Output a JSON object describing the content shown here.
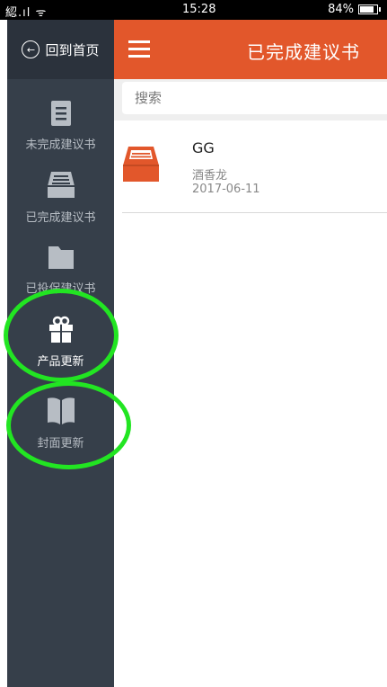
{
  "status_bar": {
    "left_text": "綛.ıl ᯤ",
    "time": "15:28",
    "battery_percent": "84%",
    "battery_level": 0.84
  },
  "sidebar": {
    "home_label": "回到首页",
    "items": [
      {
        "label": "未完成建议书",
        "icon": "document-icon",
        "active": false
      },
      {
        "label": "已完成建议书",
        "icon": "inbox-icon",
        "active": false
      },
      {
        "label": "已投保建议书",
        "icon": "folder-icon",
        "active": false
      },
      {
        "label": "产品更新",
        "icon": "gift-icon",
        "active": true
      },
      {
        "label": "封面更新",
        "icon": "book-icon",
        "active": false
      }
    ]
  },
  "header": {
    "title": "已完成建议书",
    "menu_icon": "hamburger-menu-icon"
  },
  "search": {
    "placeholder": "搜索"
  },
  "list": [
    {
      "title": "GG",
      "subtitle": "酒香龙",
      "date": "2017-06-11",
      "icon": "inbox-tray-icon"
    }
  ],
  "colors": {
    "accent": "#e2572b",
    "sidebar_bg": "#363f4a",
    "highlight": "#22e522"
  }
}
